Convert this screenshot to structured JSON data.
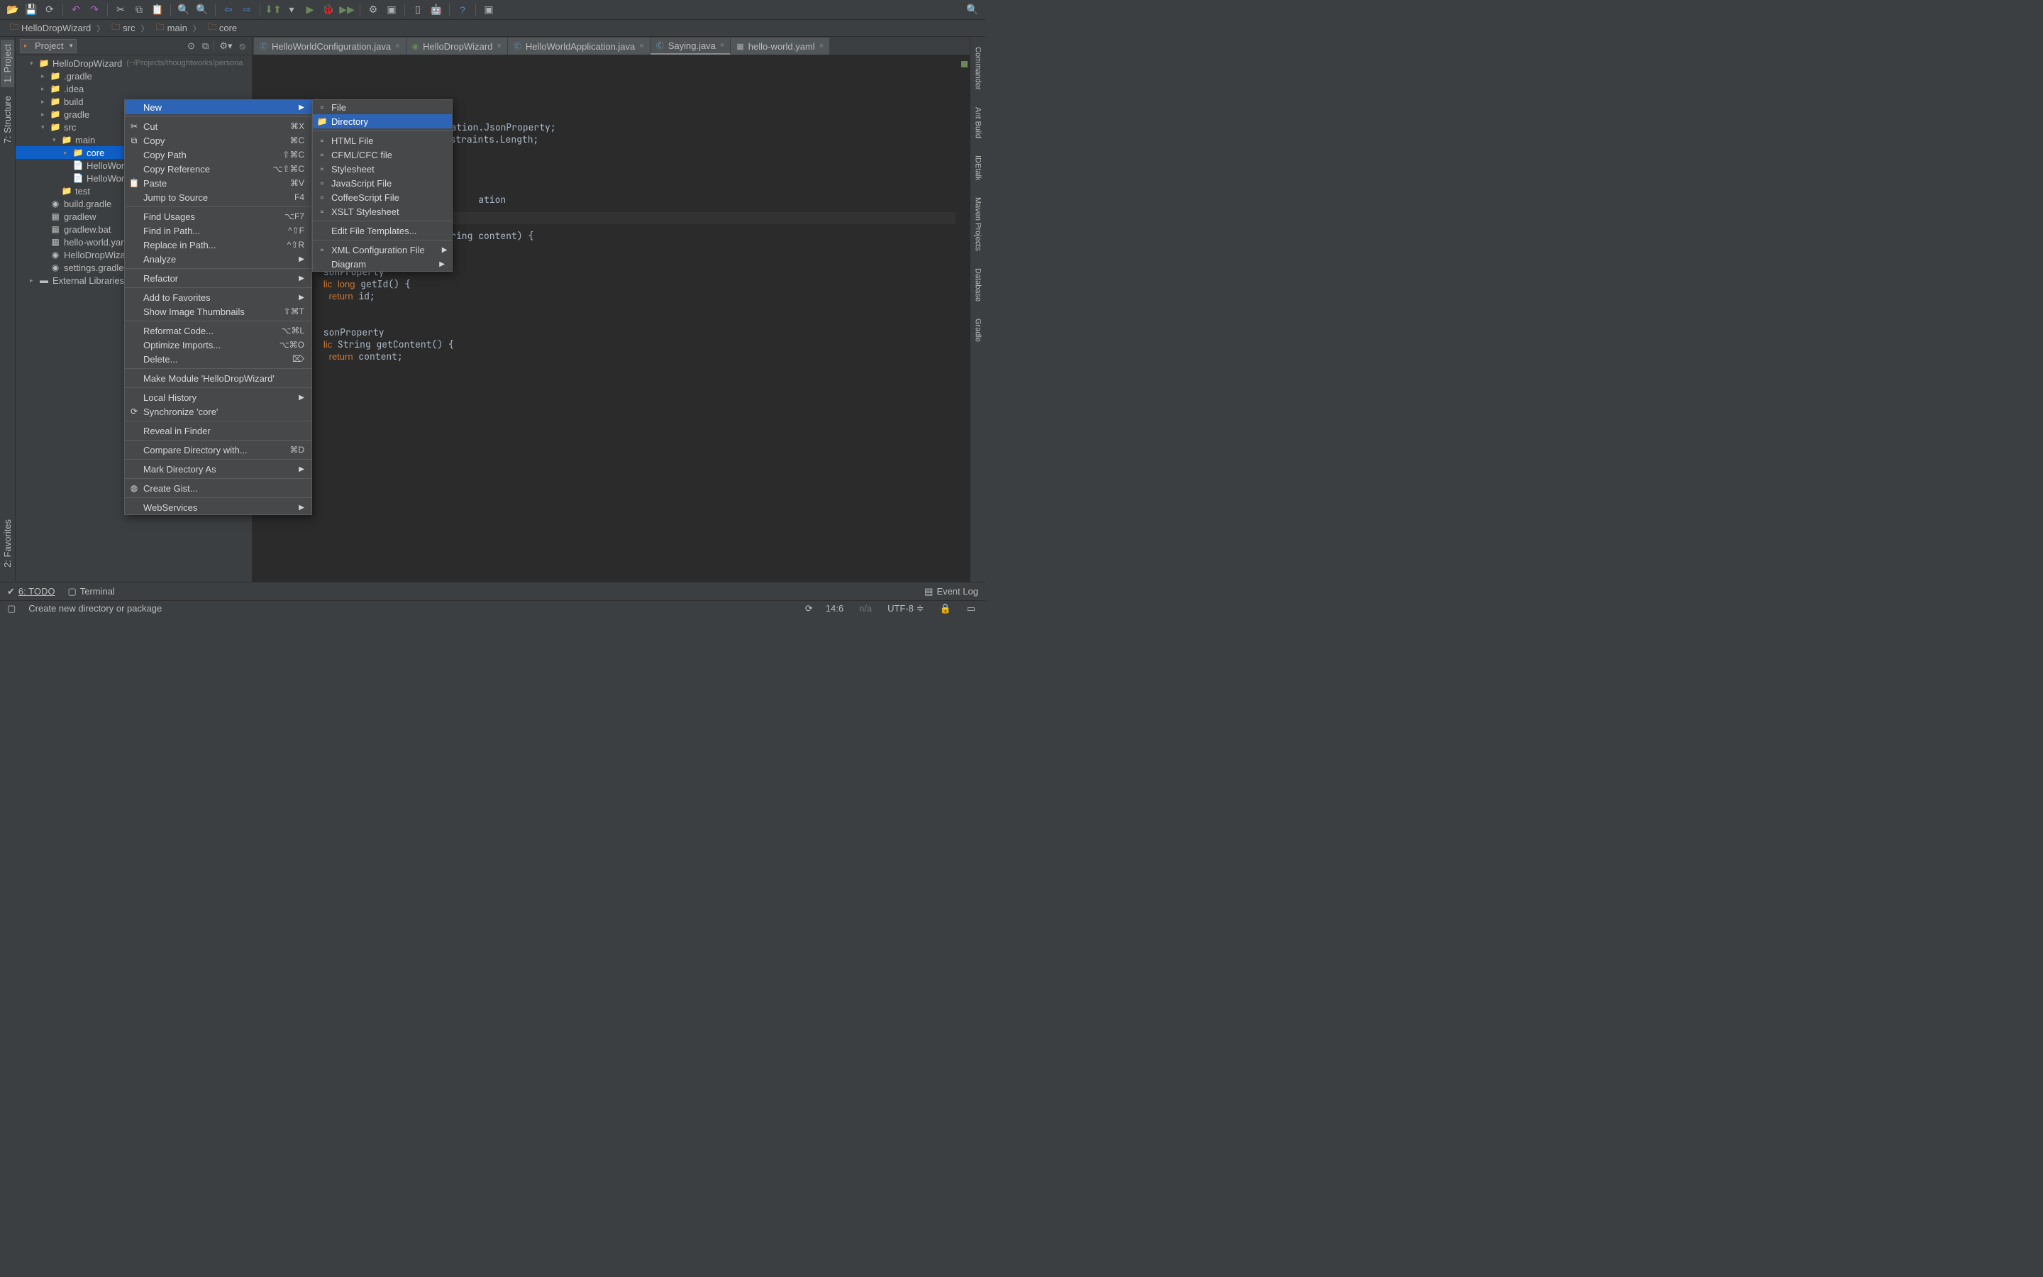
{
  "breadcrumbs": [
    "HelloDropWizard",
    "src",
    "main",
    "core"
  ],
  "project_panel": {
    "title": "Project",
    "tree": [
      {
        "depth": 0,
        "arrow": "▾",
        "icon": "📁",
        "name": "HelloDropWizard",
        "hint": "(~/Projects/thoughtworks/persona"
      },
      {
        "depth": 1,
        "arrow": "▸",
        "icon": "📁",
        "name": ".gradle"
      },
      {
        "depth": 1,
        "arrow": "▸",
        "icon": "📁",
        "name": ".idea"
      },
      {
        "depth": 1,
        "arrow": "▸",
        "icon": "📁",
        "name": "build"
      },
      {
        "depth": 1,
        "arrow": "▸",
        "icon": "📁",
        "name": "gradle"
      },
      {
        "depth": 1,
        "arrow": "▾",
        "icon": "📁",
        "name": "src"
      },
      {
        "depth": 2,
        "arrow": "▾",
        "icon": "📁",
        "name": "main"
      },
      {
        "depth": 3,
        "arrow": "▸",
        "icon": "📁",
        "name": "core",
        "selected": true
      },
      {
        "depth": 3,
        "arrow": "",
        "icon": "📄",
        "name": "HelloWorld"
      },
      {
        "depth": 3,
        "arrow": "",
        "icon": "📄",
        "name": "HelloWorld"
      },
      {
        "depth": 2,
        "arrow": "",
        "icon": "📁",
        "name": "test"
      },
      {
        "depth": 1,
        "arrow": "",
        "icon": "◉",
        "name": "build.gradle"
      },
      {
        "depth": 1,
        "arrow": "",
        "icon": "▦",
        "name": "gradlew"
      },
      {
        "depth": 1,
        "arrow": "",
        "icon": "▦",
        "name": "gradlew.bat"
      },
      {
        "depth": 1,
        "arrow": "",
        "icon": "▦",
        "name": "hello-world.yaml"
      },
      {
        "depth": 1,
        "arrow": "",
        "icon": "◉",
        "name": "HelloDropWizard."
      },
      {
        "depth": 1,
        "arrow": "",
        "icon": "◉",
        "name": "settings.gradle"
      },
      {
        "depth": 0,
        "arrow": "▸",
        "icon": "▬",
        "name": "External Libraries"
      }
    ]
  },
  "editor_tabs": [
    {
      "icon": "Ⓒ",
      "label": "HelloWorldConfiguration.java",
      "active": false,
      "iconColor": "#6e9cbe"
    },
    {
      "icon": "◉",
      "label": "HelloDropWizard",
      "active": false,
      "iconColor": "#6a8759"
    },
    {
      "icon": "Ⓒ",
      "label": "HelloWorldApplication.java",
      "active": false,
      "iconColor": "#6e9cbe"
    },
    {
      "icon": "Ⓒ",
      "label": "Saying.java",
      "active": true,
      "iconColor": "#6e9cbe"
    },
    {
      "icon": "▦",
      "label": "hello-world.yaml",
      "active": false,
      "iconColor": "#aaa"
    }
  ],
  "code_lines_full": "package main.core;\n\nimport com.fasterxml.jackson.annotation.JsonProperty;\nimport org.hibernate.validator.constraints.Length;\n\npublic class Saying {\n    private long id;\n\n    @Length(max = 3)\n    private String content;\n\n    public Saying() {\n        // Jackson deserialization\n    }\n\n    public Saying(long id, String content) {\n        this.id = id;\n        this.content = content;\n    }\n\n    @JsonProperty\n    public long getId() {\n        return id;\n    }\n\n    @JsonProperty\n    public String getContent() {\n        return content;\n    }\n}",
  "context_menu": {
    "items": [
      {
        "label": "New",
        "sub": true,
        "selected": true
      },
      {
        "divider": true
      },
      {
        "label": "Cut",
        "icon": "✂",
        "sc": "⌘X"
      },
      {
        "label": "Copy",
        "icon": "⧉",
        "sc": "⌘C"
      },
      {
        "label": "Copy Path",
        "sc": "⇧⌘C"
      },
      {
        "label": "Copy Reference",
        "sc": "⌥⇧⌘C"
      },
      {
        "label": "Paste",
        "icon": "📋",
        "sc": "⌘V"
      },
      {
        "label": "Jump to Source",
        "sc": "F4"
      },
      {
        "divider": true
      },
      {
        "label": "Find Usages",
        "sc": "⌥F7"
      },
      {
        "label": "Find in Path...",
        "sc": "^⇧F"
      },
      {
        "label": "Replace in Path...",
        "sc": "^⇧R"
      },
      {
        "label": "Analyze",
        "sub": true
      },
      {
        "divider": true
      },
      {
        "label": "Refactor",
        "sub": true
      },
      {
        "divider": true
      },
      {
        "label": "Add to Favorites",
        "sub": true
      },
      {
        "label": "Show Image Thumbnails",
        "sc": "⇧⌘T"
      },
      {
        "divider": true
      },
      {
        "label": "Reformat Code...",
        "sc": "⌥⌘L"
      },
      {
        "label": "Optimize Imports...",
        "sc": "⌥⌘O"
      },
      {
        "label": "Delete...",
        "sc": "⌦"
      },
      {
        "divider": true
      },
      {
        "label": "Make Module 'HelloDropWizard'"
      },
      {
        "divider": true
      },
      {
        "label": "Local History",
        "sub": true
      },
      {
        "label": "Synchronize 'core'",
        "icon": "⟳"
      },
      {
        "divider": true
      },
      {
        "label": "Reveal in Finder"
      },
      {
        "divider": true
      },
      {
        "label": "Compare Directory with...",
        "sc": "⌘D"
      },
      {
        "divider": true
      },
      {
        "label": "Mark Directory As",
        "sub": true
      },
      {
        "divider": true
      },
      {
        "label": "Create Gist...",
        "icon": "◍"
      },
      {
        "divider": true
      },
      {
        "label": "WebServices",
        "sub": true
      }
    ]
  },
  "submenu": {
    "items": [
      {
        "label": "File",
        "icon": "▫"
      },
      {
        "label": "Directory",
        "icon": "📁",
        "selected": true
      },
      {
        "divider": true
      },
      {
        "label": "HTML File",
        "icon": "▫"
      },
      {
        "label": "CFML/CFC file",
        "icon": "▫"
      },
      {
        "label": "Stylesheet",
        "icon": "▫"
      },
      {
        "label": "JavaScript File",
        "icon": "▫"
      },
      {
        "label": "CoffeeScript File",
        "icon": "▫"
      },
      {
        "label": "XSLT Stylesheet",
        "icon": "▫"
      },
      {
        "divider": true
      },
      {
        "label": "Edit File Templates..."
      },
      {
        "divider": true
      },
      {
        "label": "XML Configuration File",
        "icon": "▫",
        "sub": true
      },
      {
        "label": "Diagram",
        "sub": true
      }
    ]
  },
  "left_tabs": [
    {
      "label": "1: Project",
      "icon": "▸"
    },
    {
      "label": "7: Structure",
      "icon": "⧉"
    },
    {
      "label": "2: Favorites",
      "icon": "★"
    }
  ],
  "right_tabs": [
    {
      "label": "Commander",
      "icon": "▸"
    },
    {
      "label": "Ant Build",
      "icon": "✦"
    },
    {
      "label": "IDEtalk",
      "icon": "◉"
    },
    {
      "label": "Maven Projects",
      "icon": "m"
    },
    {
      "label": "Database",
      "icon": "▤"
    },
    {
      "label": "Gradle",
      "icon": "◉"
    }
  ],
  "bottom": {
    "todo": "6: TODO",
    "terminal": "Terminal",
    "eventlog": "Event Log"
  },
  "status": {
    "msg": "Create new directory or package",
    "pos": "14:6",
    "na": "n/a",
    "enc": "UTF-8"
  }
}
